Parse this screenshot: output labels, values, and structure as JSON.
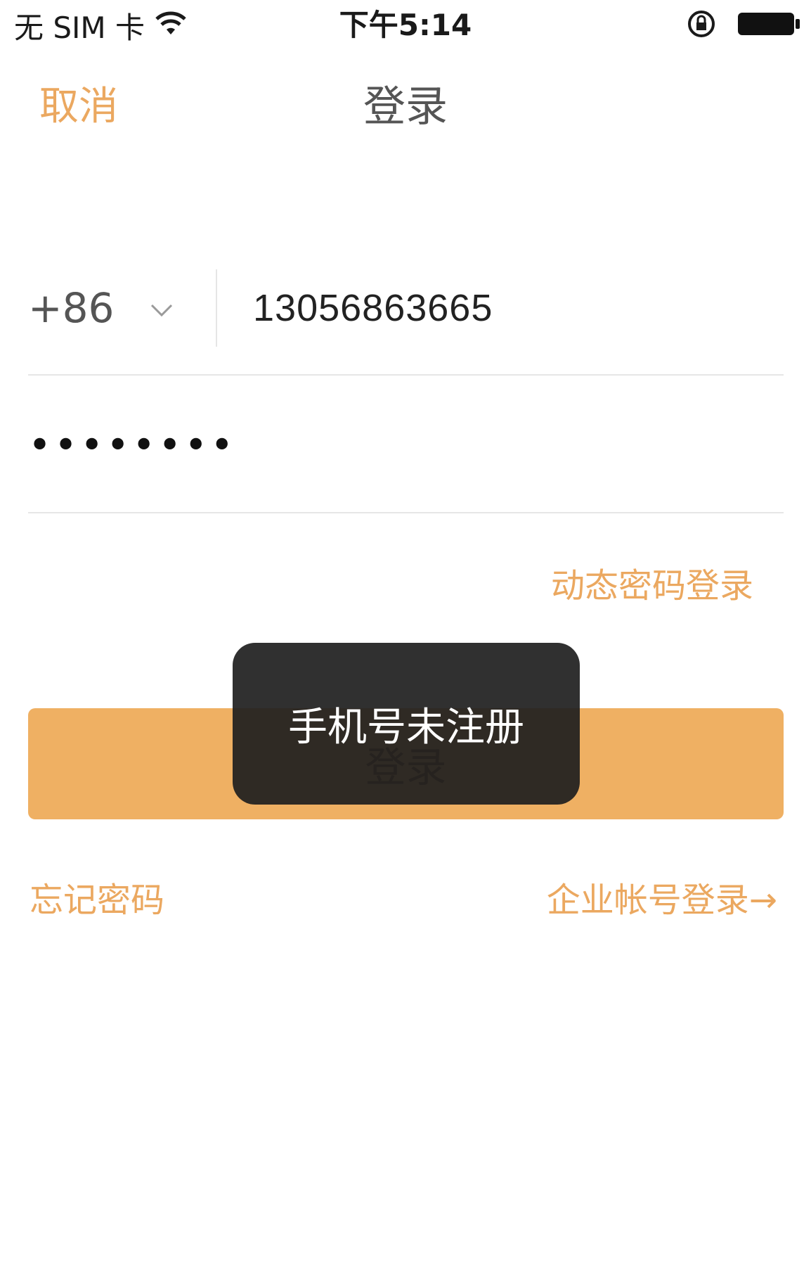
{
  "status_bar": {
    "carrier": "无 SIM 卡",
    "time": "下午5:14",
    "icons": [
      "wifi-icon",
      "rotation-lock-icon",
      "battery-icon"
    ]
  },
  "nav": {
    "cancel_label": "取消",
    "title": "登录"
  },
  "form": {
    "country_code": "+86",
    "phone_value": "13056863665",
    "password_mask": "••••••••",
    "dynamic_password_login": "动态密码登录",
    "login_button": "登录",
    "forgot_password": "忘记密码",
    "enterprise_login": "企业帐号登录→"
  },
  "toast": {
    "message": "手机号未注册"
  },
  "colors": {
    "accent": "#eba860",
    "button_bg": "#efb063",
    "toast_bg": "#1e1e1e",
    "divider": "#e6e6e6"
  }
}
